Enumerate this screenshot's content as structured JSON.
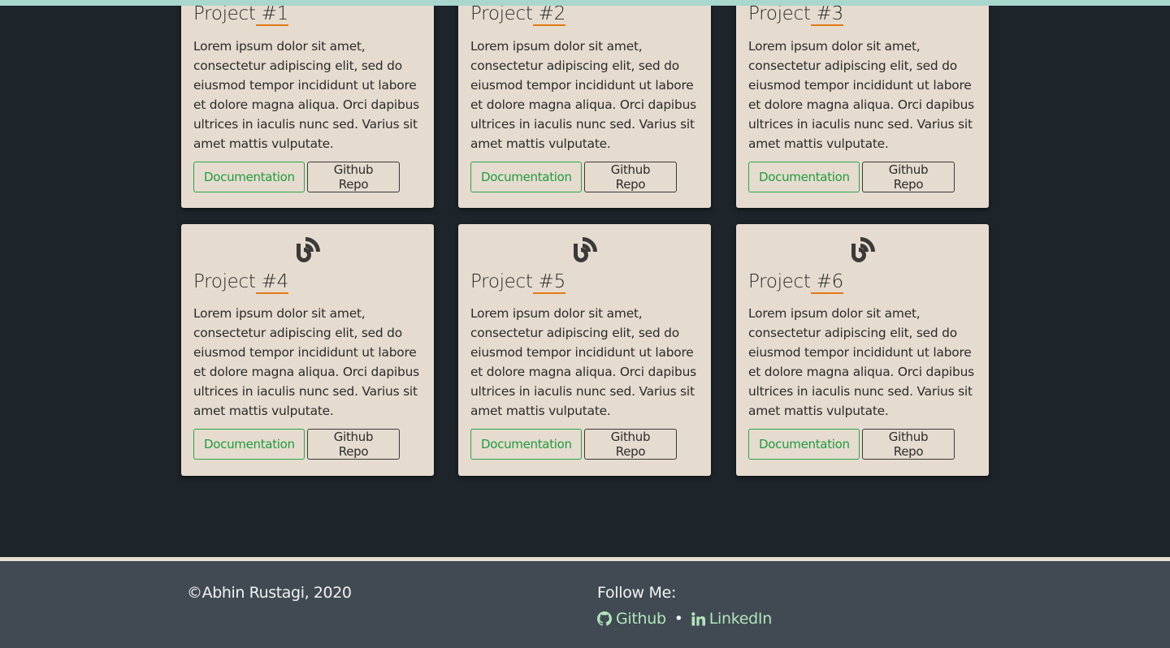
{
  "cards": [
    {
      "title_pre": "Project",
      "title_num": " #1",
      "body": "Lorem ipsum dolor sit amet, consectetur adipiscing elit, sed do eiusmod tempor incididunt ut labore et dolore magna aliqua. Orci dapibus ultrices in iaculis nunc sed. Varius sit amet mattis vulputate.",
      "doc_label": "Documentation",
      "repo_label": "Github Repo"
    },
    {
      "title_pre": "Project",
      "title_num": " #2",
      "body": "Lorem ipsum dolor sit amet, consectetur adipiscing elit, sed do eiusmod tempor incididunt ut labore et dolore magna aliqua. Orci dapibus ultrices in iaculis nunc sed. Varius sit amet mattis vulputate.",
      "doc_label": "Documentation",
      "repo_label": "Github Repo"
    },
    {
      "title_pre": "Project",
      "title_num": " #3",
      "body": "Lorem ipsum dolor sit amet, consectetur adipiscing elit, sed do eiusmod tempor incididunt ut labore et dolore magna aliqua. Orci dapibus ultrices in iaculis nunc sed. Varius sit amet mattis vulputate.",
      "doc_label": "Documentation",
      "repo_label": "Github Repo"
    },
    {
      "title_pre": "Project",
      "title_num": " #4",
      "body": "Lorem ipsum dolor sit amet, consectetur adipiscing elit, sed do eiusmod tempor incididunt ut labore et dolore magna aliqua. Orci dapibus ultrices in iaculis nunc sed. Varius sit amet mattis vulputate.",
      "doc_label": "Documentation",
      "repo_label": "Github Repo"
    },
    {
      "title_pre": "Project",
      "title_num": " #5",
      "body": "Lorem ipsum dolor sit amet, consectetur adipiscing elit, sed do eiusmod tempor incididunt ut labore et dolore magna aliqua. Orci dapibus ultrices in iaculis nunc sed. Varius sit amet mattis vulputate.",
      "doc_label": "Documentation",
      "repo_label": "Github Repo"
    },
    {
      "title_pre": "Project",
      "title_num": " #6",
      "body": "Lorem ipsum dolor sit amet, consectetur adipiscing elit, sed do eiusmod tempor incididunt ut labore et dolore magna aliqua. Orci dapibus ultrices in iaculis nunc sed. Varius sit amet mattis vulputate.",
      "doc_label": "Documentation",
      "repo_label": "Github Repo"
    }
  ],
  "card_icon": "blog-feed-icon",
  "footer": {
    "copyright": "©Abhin Rustagi, 2020",
    "follow_label": "Follow Me:",
    "github_label": "Github",
    "separator": "•",
    "linkedin_label": "LinkedIn",
    "github_icon": "github-icon",
    "linkedin_icon": "linkedin-icon"
  },
  "colors": {
    "background": "#1d252b",
    "top_bar": "#a9d6cd",
    "card": "#e5dbcf",
    "accent_underline": "#e07c16",
    "doc_button": "#27a745",
    "footer": "#414a53",
    "footer_link": "#b0e6b9"
  }
}
